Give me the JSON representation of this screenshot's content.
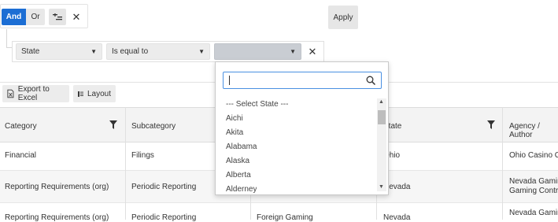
{
  "filter": {
    "and_label": "And",
    "or_label": "Or",
    "apply_label": "Apply",
    "condition": {
      "field": "State",
      "operator": "Is equal to",
      "value": ""
    }
  },
  "toolbar": {
    "export_label": "Export to Excel",
    "layout_label": "Layout"
  },
  "grid": {
    "columns": [
      "Category",
      "Subcategory",
      "State",
      "Agency / Author"
    ],
    "rows": [
      [
        "Financial",
        "Filings",
        "",
        "Ohio",
        "Ohio Casino Co"
      ],
      [
        "Reporting Requirements (org)",
        "Periodic Reporting",
        "",
        "Nevada",
        "Nevada Gaming\nGaming Control"
      ],
      [
        "Reporting Requirements (org)",
        "Periodic Reporting",
        "Foreign Gaming",
        "Nevada",
        "Nevada Gaming"
      ]
    ]
  },
  "dropdown": {
    "search_value": "",
    "options": [
      "--- Select State ---",
      "Aichi",
      "Akita",
      "Alabama",
      "Alaska",
      "Alberta",
      "Alderney"
    ]
  },
  "colors": {
    "primary": "#1c6ed4",
    "focus": "#4a90e2"
  }
}
